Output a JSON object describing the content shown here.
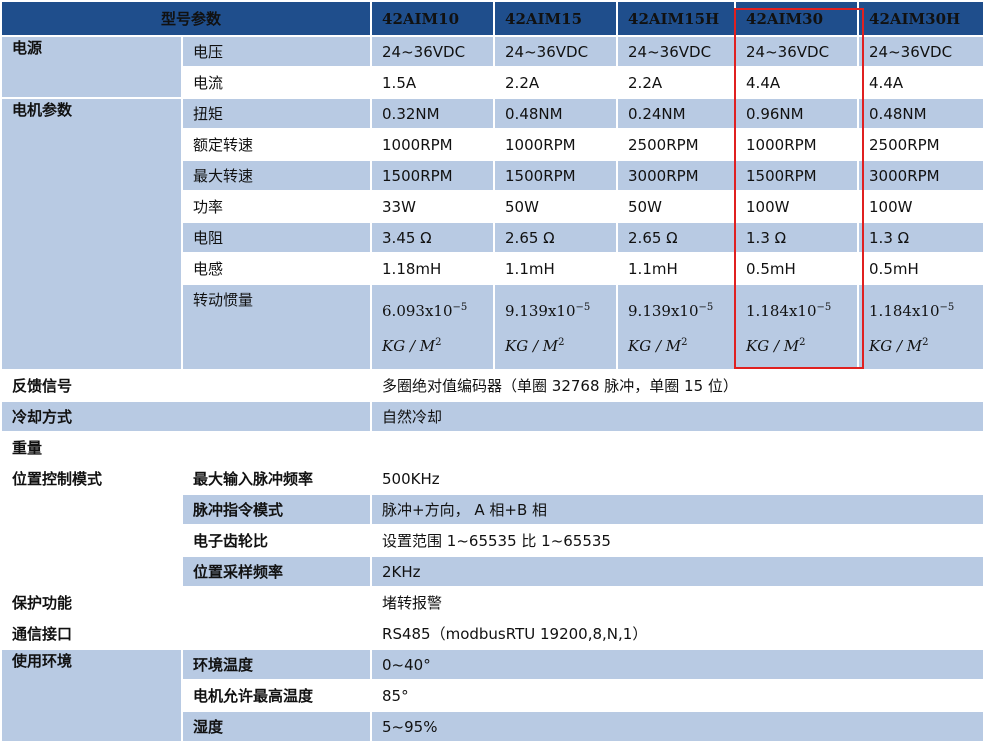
{
  "header": {
    "param": "型号参数",
    "models": [
      "42AIM10",
      "42AIM15",
      "42AIM15H",
      "42AIM30",
      "42AIM30H"
    ]
  },
  "power": {
    "group": "电源",
    "voltage": {
      "label": "电压",
      "values": [
        "24~36VDC",
        "24~36VDC",
        "24~36VDC",
        "24~36VDC",
        "24~36VDC"
      ]
    },
    "current": {
      "label": "电流",
      "values": [
        "1.5A",
        "2.2A",
        "2.2A",
        "4.4A",
        "4.4A"
      ]
    }
  },
  "motor": {
    "group": "电机参数",
    "torque": {
      "label": "扭矩",
      "values": [
        "0.32NM",
        "0.48NM",
        "0.24NM",
        "0.96NM",
        "0.48NM"
      ]
    },
    "rated_speed": {
      "label": "额定转速",
      "values": [
        "1000RPM",
        "1000RPM",
        "2500RPM",
        "1000RPM",
        "2500RPM"
      ]
    },
    "max_speed": {
      "label": "最大转速",
      "values": [
        "1500RPM",
        "1500RPM",
        "3000RPM",
        "1500RPM",
        "3000RPM"
      ]
    },
    "power": {
      "label": "功率",
      "values": [
        "33W",
        "50W",
        "50W",
        "100W",
        "100W"
      ]
    },
    "resistance": {
      "label": "电阻",
      "values": [
        "3.45 Ω",
        "2.65 Ω",
        "2.65 Ω",
        "1.3 Ω",
        "1.3 Ω"
      ]
    },
    "inductance": {
      "label": "电感",
      "values": [
        "1.18mH",
        "1.1mH",
        "1.1mH",
        "0.5mH",
        "0.5mH"
      ]
    },
    "inertia": {
      "label": "转动惯量",
      "values": [
        "6.093x10",
        "9.139x10",
        "9.139x10",
        "1.184x10",
        "1.184x10"
      ],
      "exponent": "−5",
      "unit": "KG / M",
      "unit_exp": "2"
    }
  },
  "feedback": {
    "label": "反馈信号",
    "value": "多圈绝对值编码器（单圈 32768 脉冲，单圈 15 位）"
  },
  "cooling": {
    "label": "冷却方式",
    "value": "自然冷却"
  },
  "weight": {
    "label": "重量",
    "value": ""
  },
  "position_control": {
    "group": "位置控制模式",
    "max_pulse_freq": {
      "label": "最大输入脉冲频率",
      "value": "500KHz"
    },
    "pulse_mode": {
      "label": "脉冲指令模式",
      "value": "脉冲+方向，  A 相+B 相"
    },
    "gear_ratio": {
      "label": "电子齿轮比",
      "value": "设置范围 1~65535 比 1~65535"
    },
    "sampling_freq": {
      "label": "位置采样频率",
      "value": "2KHz"
    }
  },
  "protection": {
    "label": "保护功能",
    "value": "堵转报警"
  },
  "comm": {
    "label": "通信接口",
    "value": "RS485（modbusRTU   19200,8,N,1）"
  },
  "environment": {
    "group": "使用环境",
    "ambient_temp": {
      "label": "环境温度",
      "value": "0~40°"
    },
    "max_motor_temp": {
      "label": "电机允许最高温度",
      "value": "85°"
    },
    "humidity": {
      "label": "湿度",
      "value": "5~95%"
    }
  },
  "colors": {
    "header_bg": "#1f4e8c",
    "row_blue": "#b8cae3",
    "highlight": "#e02020"
  }
}
